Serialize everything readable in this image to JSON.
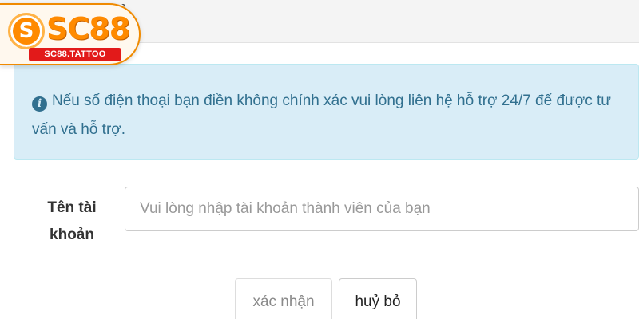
{
  "header": {
    "partial_title": "ả"
  },
  "logo": {
    "coin_glyph": "S",
    "word": "SC88",
    "tagline": "SC88.TATTOO"
  },
  "alert": {
    "icon": "info-circle-icon",
    "message": "Nếu số điện thoại bạn điền không chính xác vui lòng liên hệ hỗ trợ 24/7 để được tư vấn và hỗ trợ."
  },
  "form": {
    "username_label": "Tên tài khoản",
    "username_placeholder": "Vui lòng nhập tài khoản thành viên của bạn",
    "username_value": ""
  },
  "buttons": {
    "confirm_label": "xác nhận",
    "cancel_label": "huỷ bỏ"
  },
  "colors": {
    "alert_background": "#d9edf7",
    "alert_text": "#31708f",
    "brand_orange": "#ff8a00",
    "brand_red": "#e21a1a"
  }
}
